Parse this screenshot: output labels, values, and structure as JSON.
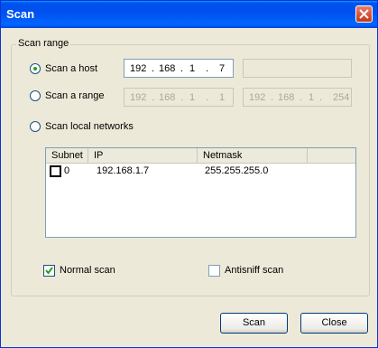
{
  "window": {
    "title": "Scan"
  },
  "group": {
    "legend": "Scan range"
  },
  "options": {
    "scan_host": {
      "label": "Scan a host",
      "selected": true,
      "ip": [
        "192",
        "168",
        "1",
        "7"
      ]
    },
    "scan_range": {
      "label": "Scan a range",
      "selected": false,
      "from": [
        "192",
        "168",
        "1",
        "1"
      ],
      "to": [
        "192",
        "168",
        "1",
        "254"
      ]
    },
    "scan_local": {
      "label": "Scan local networks",
      "selected": false
    }
  },
  "table": {
    "columns": [
      "Subnet",
      "IP",
      "Netmask"
    ],
    "rows": [
      {
        "subnet": "0",
        "ip": "192.168.1.7",
        "netmask": "255.255.255.0",
        "checked": false
      }
    ]
  },
  "checkboxes": {
    "normal_scan": {
      "label": "Normal scan",
      "checked": true
    },
    "antisniff_scan": {
      "label": "Antisniff scan",
      "checked": false
    }
  },
  "buttons": {
    "scan": "Scan",
    "close": "Close"
  },
  "colors": {
    "titlebar": "#0058ee",
    "window_bg": "#ece9d8",
    "radio_dot": "#21a121"
  },
  "icons": {
    "close": "close-icon",
    "check": "checkmark-icon"
  }
}
